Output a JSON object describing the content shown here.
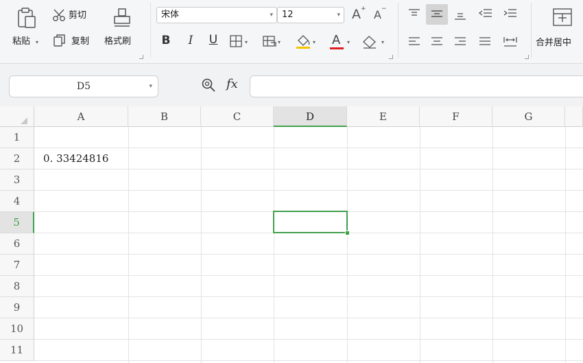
{
  "ribbon": {
    "paste_label": "粘贴",
    "cut_label": "剪切",
    "copy_label": "复制",
    "format_painter_label": "格式刷",
    "font_name": "宋体",
    "font_size": "12",
    "merge_center_label": "合并居中",
    "bold": "B",
    "italic": "I",
    "underline": "U",
    "font_color_letter": "A",
    "font_color": "#e02020",
    "fill_color": "#f5c400"
  },
  "formula_bar": {
    "cell_reference": "D5",
    "fx_label": "fx",
    "formula_value": ""
  },
  "sheet": {
    "columns": [
      "A",
      "B",
      "C",
      "D",
      "E",
      "F",
      "G"
    ],
    "rows": [
      "1",
      "2",
      "3",
      "4",
      "5",
      "6",
      "7",
      "8",
      "9",
      "10",
      "11"
    ],
    "active_column": "D",
    "active_row": "5",
    "cells": {
      "A2": "0. 33424816"
    }
  },
  "colors": {
    "selection": "#3f9f4a"
  }
}
